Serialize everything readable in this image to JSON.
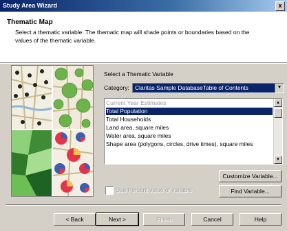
{
  "window": {
    "title": "Study Area Wizard",
    "close_glyph": "x"
  },
  "header": {
    "title": "Thematic Map",
    "description": "Select a thematic variable.  The thematic map will shade points or boundaries based on the values of the thematic variable."
  },
  "panel": {
    "select_label": "Select a Thematic Variable",
    "category_label": "Category:",
    "category_value": "Claritas Sample DatabaseTable of Contents"
  },
  "variables": {
    "items": [
      {
        "label": "Current Year Estimates",
        "style": "header"
      },
      {
        "label": "Total Population",
        "style": "selected"
      },
      {
        "label": "Total Households",
        "style": "normal"
      },
      {
        "label": "Land area, square miles",
        "style": "normal"
      },
      {
        "label": "Water area, square miles",
        "style": "normal"
      },
      {
        "label": "Shape area (polygons, circles, drive times), square miles",
        "style": "normal"
      }
    ]
  },
  "options": {
    "use_percent_label": "Use Percent value of variable",
    "use_percent_checked": false
  },
  "buttons": {
    "customize": "Customize Variable...",
    "find": "Find Variable...",
    "back": "< Back",
    "next": "Next >",
    "finish": "Finish",
    "cancel": "Cancel",
    "help": "Help"
  },
  "colors": {
    "selection": "#0a246a",
    "face": "#d4d0c8",
    "title_gradient_start": "#0a246a"
  }
}
